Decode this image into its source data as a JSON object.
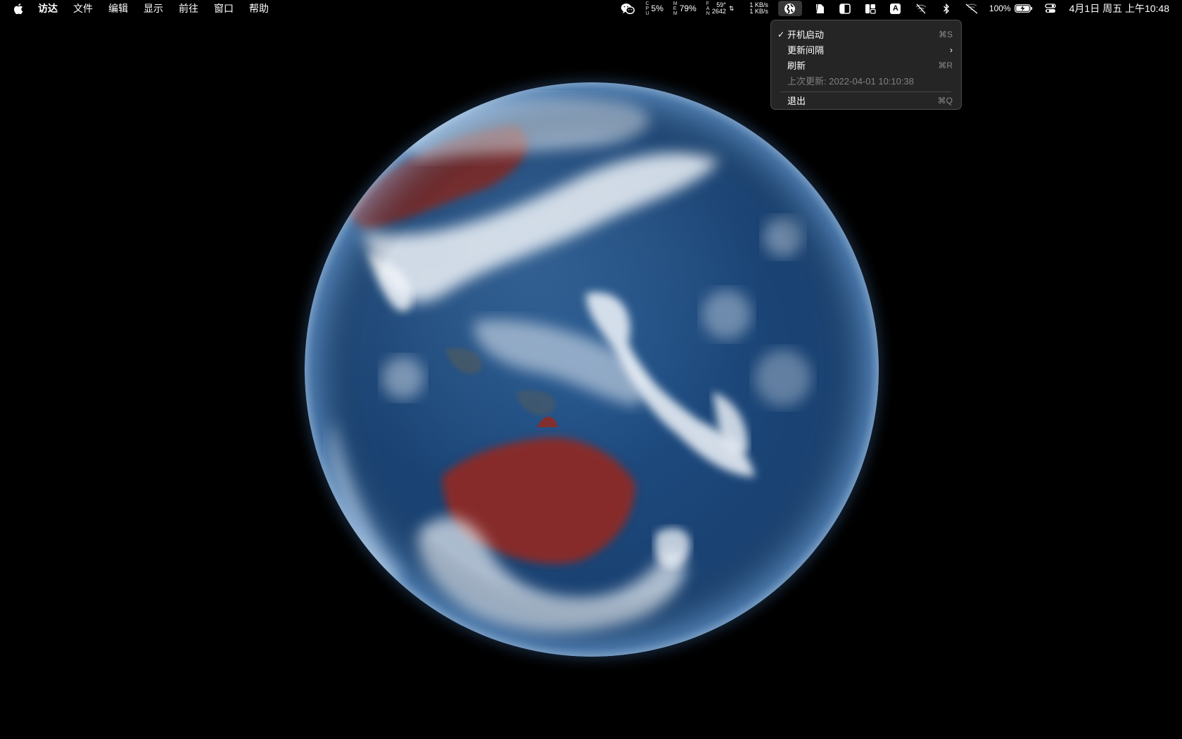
{
  "menubar": {
    "app_menus": [
      "访达",
      "文件",
      "编辑",
      "显示",
      "前往",
      "窗口",
      "帮助"
    ],
    "status": {
      "cpu_label_lines": [
        "C",
        "P",
        "U"
      ],
      "cpu_value": "5%",
      "mem_label_lines": [
        "M",
        "E",
        "M"
      ],
      "mem_value": "79%",
      "fan_label_lines": [
        "F",
        "A",
        "N"
      ],
      "sensor_temp": "59°",
      "sensor_rpm": "2642",
      "net_up": "1 KB/s",
      "net_down": "1 KB/s",
      "battery_percent": "100%",
      "clock": "4月1日 周五 上午10:48"
    },
    "icons": [
      "wechat-icon",
      "globe-icon",
      "doc-icon",
      "sidebar-icon",
      "layout-icon",
      "input-source-icon",
      "wifi-off-icon",
      "bluetooth-icon",
      "airplay-off-icon",
      "battery-icon",
      "control-center-icon"
    ],
    "input_source_letter": "A"
  },
  "dropdown": {
    "items": [
      {
        "label": "开机启动",
        "checked": true,
        "shortcut": "⌘S"
      },
      {
        "label": "更新间隔",
        "submenu": true,
        "arrow": "›"
      },
      {
        "label": "刷新",
        "shortcut": "⌘R"
      },
      {
        "label": "上次更新: 2022-04-01 10:10:38",
        "disabled": true
      },
      {
        "label": "退出",
        "shortcut": "⌘Q"
      }
    ],
    "check_mark": "✓"
  },
  "colors": {
    "menubar_bg": "#000000",
    "menu_bg": "#262628",
    "ocean": "#1a4272",
    "clouds": "#f2f6fb",
    "land_red": "#8c2b26"
  }
}
